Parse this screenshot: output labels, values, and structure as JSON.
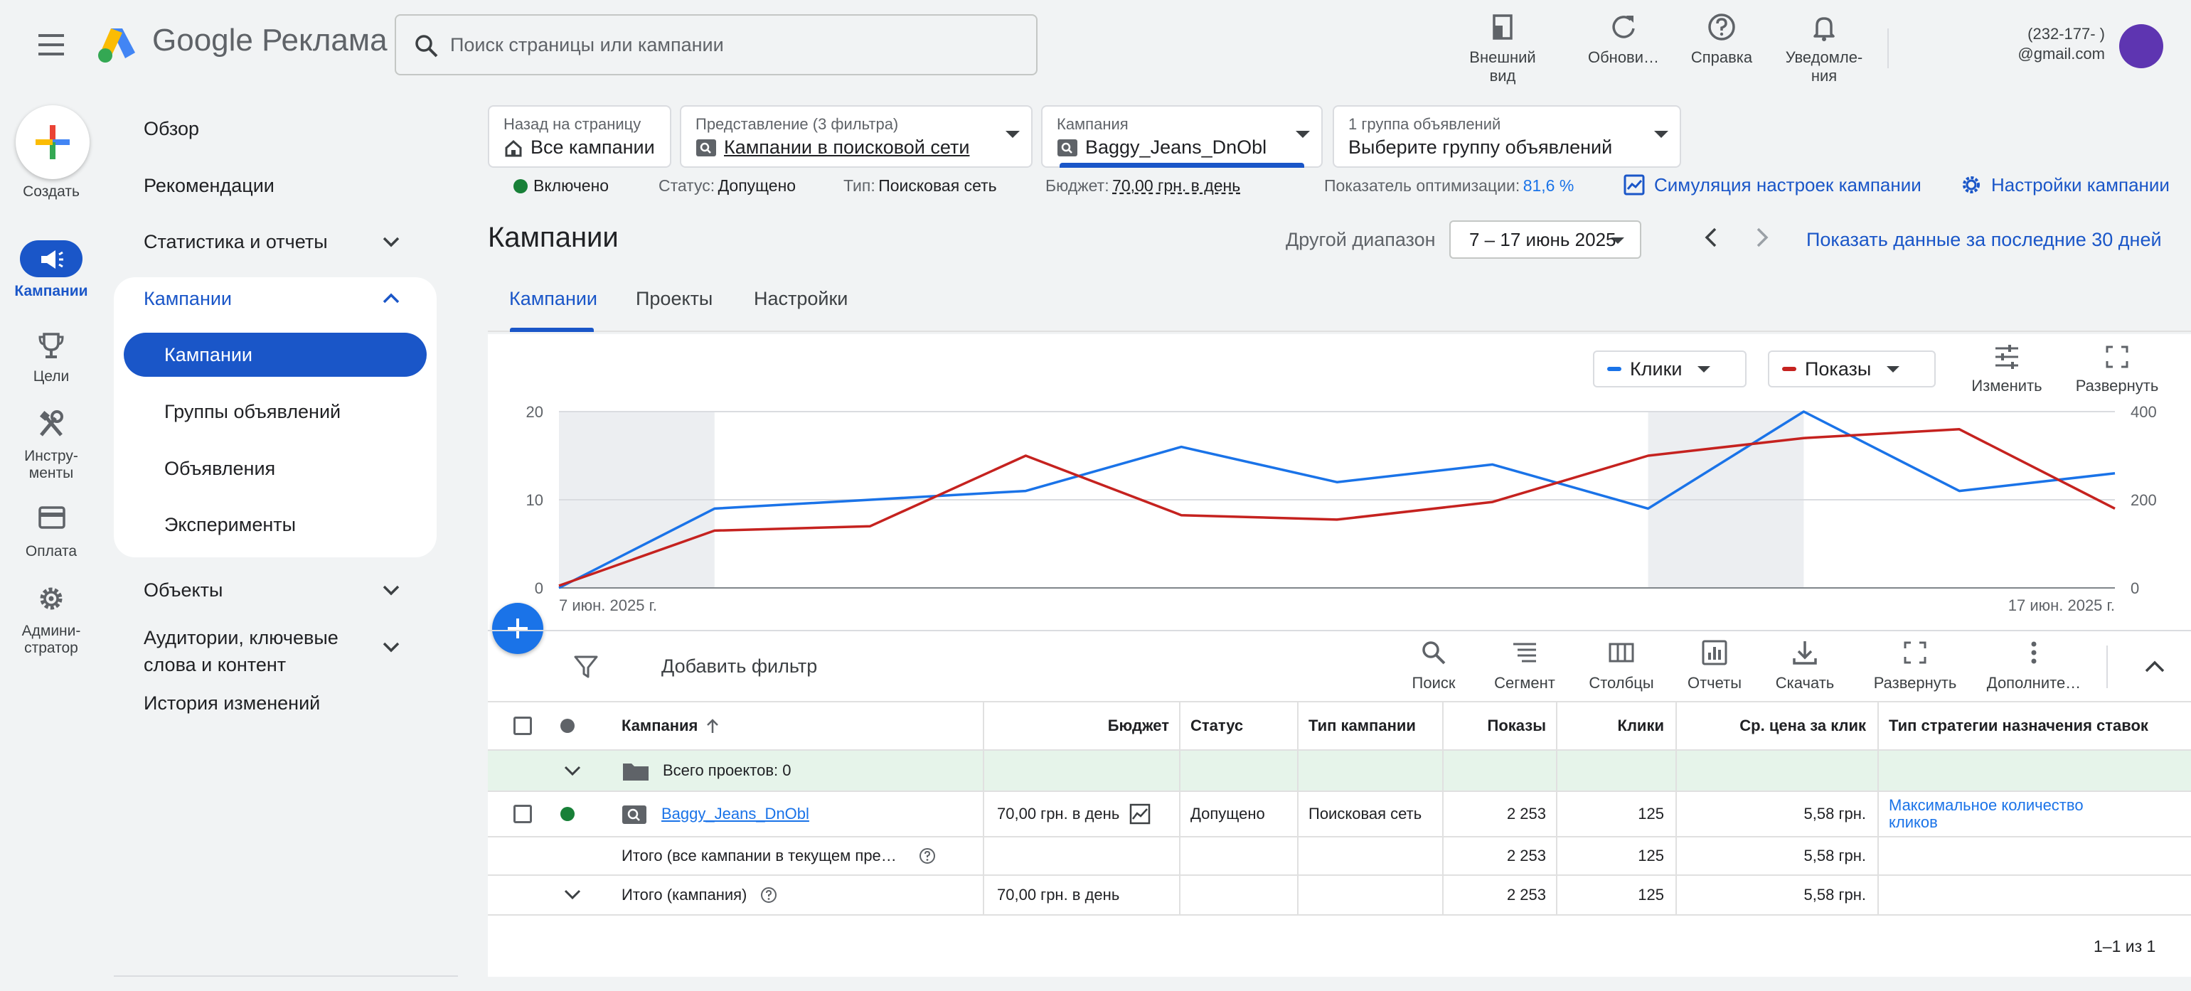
{
  "app": {
    "title_google": "Google",
    "title_product": "Реклама",
    "search_placeholder": "Поиск страницы или кампании"
  },
  "header_actions": [
    {
      "label": "Внешний вид",
      "icon": "appearance-icon"
    },
    {
      "label": "Обнови…",
      "icon": "refresh-icon"
    },
    {
      "label": "Справка",
      "icon": "help-icon"
    },
    {
      "label": "Уведомле-ния",
      "icon": "bell-icon"
    }
  ],
  "account": {
    "line1": "(232-177-      )",
    "line2": "@gmail.com",
    "avatar_color": "#5e35b1"
  },
  "rail": {
    "create": "Создать",
    "items": [
      {
        "label": "Кампании",
        "icon": "megaphone-icon",
        "active": true
      },
      {
        "label": "Цели",
        "icon": "trophy-icon"
      },
      {
        "label": "Инстру-менты",
        "icon": "tools-icon"
      },
      {
        "label": "Оплата",
        "icon": "card-icon"
      },
      {
        "label": "Админи-стратор",
        "icon": "gear-icon"
      }
    ]
  },
  "nav": {
    "overview": "Обзор",
    "recommendations": "Рекомендации",
    "stats": "Статистика и отчеты",
    "campaigns_group": "Кампании",
    "sub": [
      "Кампании",
      "Группы объявлений",
      "Объявления",
      "Эксперименты"
    ],
    "objects": "Объекты",
    "audiences_line1": "Аудитории, ключевые",
    "audiences_line2": "слова и контент",
    "history": "История изменений"
  },
  "filters": {
    "back": {
      "small": "Назад на страницу",
      "big": "Все кампании"
    },
    "view": {
      "small": "Представление (3 фильтра)",
      "big": "Кампании в поисковой сети"
    },
    "campaign": {
      "small": "Кампания",
      "big": "Baggy_Jeans_DnObl"
    },
    "adgroup": {
      "small": "1 группа объявлений",
      "big": "Выберите группу объявлений"
    }
  },
  "status_row": {
    "enabled": "Включено",
    "status_label": "Статус:",
    "status_value": "Допущено",
    "type_label": "Тип:",
    "type_value": "Поисковая сеть",
    "budget_label": "Бюджет:",
    "budget_value": "70,00 грн. в день",
    "opt_label": "Показатель оптимизации:",
    "opt_value": "81,6 %",
    "simulate": "Симуляция настроек кампании",
    "settings": "Настройки кампании"
  },
  "page": {
    "title": "Кампании",
    "range_label": "Другой диапазон",
    "range_value": "7 – 17 июнь 2025",
    "last30": "Показать данные за последние 30 дней",
    "tabs": [
      "Кампании",
      "Проекты",
      "Настройки"
    ]
  },
  "chart_controls": {
    "metric1": "Клики",
    "metric1_color": "#1a73e8",
    "metric2": "Показы",
    "metric2_color": "#c5221f",
    "edit": "Изменить",
    "expand": "Развернуть"
  },
  "chart_data": {
    "type": "line",
    "x": [
      "7 июн. 2025 г.",
      "8 июн.",
      "9 июн.",
      "10 июн.",
      "11 июн.",
      "12 июн.",
      "13 июн.",
      "14 июн.",
      "15 июн.",
      "16 июн.",
      "17 июн. 2025 г."
    ],
    "x_tick_labels": [
      "7 июн. 2025 г.",
      "17 июн. 2025 г."
    ],
    "series": [
      {
        "name": "Клики",
        "axis": "left",
        "color": "#1a73e8",
        "values": [
          0,
          9,
          10,
          11,
          16,
          12,
          14,
          9,
          20,
          11,
          13
        ]
      },
      {
        "name": "Показы",
        "axis": "right",
        "color": "#c5221f",
        "values": [
          5,
          130,
          140,
          300,
          165,
          155,
          195,
          300,
          340,
          360,
          180
        ]
      }
    ],
    "y_left": {
      "ticks": [
        "0",
        "10",
        "20"
      ],
      "range": [
        0,
        20
      ]
    },
    "y_right": {
      "ticks": [
        "0",
        "200",
        "400"
      ],
      "range": [
        0,
        400
      ]
    },
    "shaded_ranges": [
      [
        0,
        1
      ],
      [
        7,
        8
      ]
    ],
    "grid": true
  },
  "table_toolbar": {
    "add_filter": "Добавить фильтр",
    "buttons": [
      {
        "label": "Поиск",
        "icon": "search-icon"
      },
      {
        "label": "Сегмент",
        "icon": "segment-icon"
      },
      {
        "label": "Столбцы",
        "icon": "columns-icon"
      },
      {
        "label": "Отчеты",
        "icon": "reports-icon"
      },
      {
        "label": "Скачать",
        "icon": "download-icon"
      },
      {
        "label": "Развернуть",
        "icon": "fullscreen-icon"
      },
      {
        "label": "Дополните…",
        "icon": "more-vert-icon"
      }
    ]
  },
  "table": {
    "headers": [
      "Кампания",
      "Бюджет",
      "Статус",
      "Тип кампании",
      "Показы",
      "Клики",
      "Ср. цена за клик",
      "Тип стратегии назначения ставок"
    ],
    "projects_row": "Всего проектов: 0",
    "campaign_row": {
      "name": "Baggy_Jeans_DnObl",
      "budget": "70,00 грн. в день",
      "status": "Допущено",
      "type": "Поисковая сеть",
      "impressions": "2 253",
      "clicks": "125",
      "cpc": "5,58 грн.",
      "strategy_line1": "Максимальное количество",
      "strategy_line2": "кликов"
    },
    "total_all": {
      "label": "Итого (все кампании в текущем пре…",
      "impressions": "2 253",
      "clicks": "125",
      "cpc": "5,58 грн."
    },
    "total_campaign": {
      "label": "Итого (кампания)",
      "budget": "70,00 грн. в день",
      "impressions": "2 253",
      "clicks": "125",
      "cpc": "5,58 грн."
    },
    "pagination": "1–1 из 1"
  }
}
